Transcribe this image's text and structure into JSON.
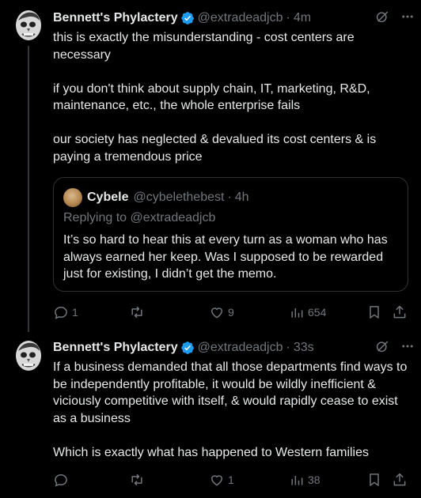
{
  "tweets": [
    {
      "author": "Bennett's Phylactery",
      "handle": "@extradeadjcb",
      "separator": "·",
      "time": "4m",
      "paragraphs": [
        "this is exactly the misunderstanding - cost centers are necessary",
        "if you don't think about supply chain, IT, marketing, R&D, maintenance, etc., the whole enterprise fails",
        "our society has neglected & devalued its cost centers & is paying a tremendous price"
      ],
      "quote": {
        "author": "Cybele",
        "handle": "@cybelethebest",
        "separator": "·",
        "time": "4h",
        "replying_prefix": "Replying to",
        "replying_to": "@extradeadjcb",
        "text": "It’s so hard to hear this at every turn as a woman who has always earned her keep. Was I supposed to be rewarded just for existing, I didn’t get the memo."
      },
      "stats": {
        "replies": "1",
        "reposts": "",
        "likes": "9",
        "views": "654"
      }
    },
    {
      "author": "Bennett's Phylactery",
      "handle": "@extradeadjcb",
      "separator": "·",
      "time": "33s",
      "paragraphs": [
        "If a business demanded that all those departments find ways to be independently profitable, it would be wildly inefficient & viciously competitive with itself, & would rapidly cease to exist as a business",
        "Which is exactly what has happened to Western families"
      ],
      "stats": {
        "replies": "",
        "reposts": "",
        "likes": "1",
        "views": "38"
      }
    }
  ],
  "icons": {
    "verified": "verified-badge-icon",
    "grok": "grok-icon",
    "more": "more-icon",
    "reply": "reply-icon",
    "repost": "repost-icon",
    "like": "like-icon",
    "views": "views-icon",
    "bookmark": "bookmark-icon",
    "share": "share-icon"
  },
  "colors": {
    "background": "#000000",
    "text": "#e7e9ea",
    "muted": "#71767b",
    "verified": "#1d9bf0",
    "border": "#2f3336"
  }
}
